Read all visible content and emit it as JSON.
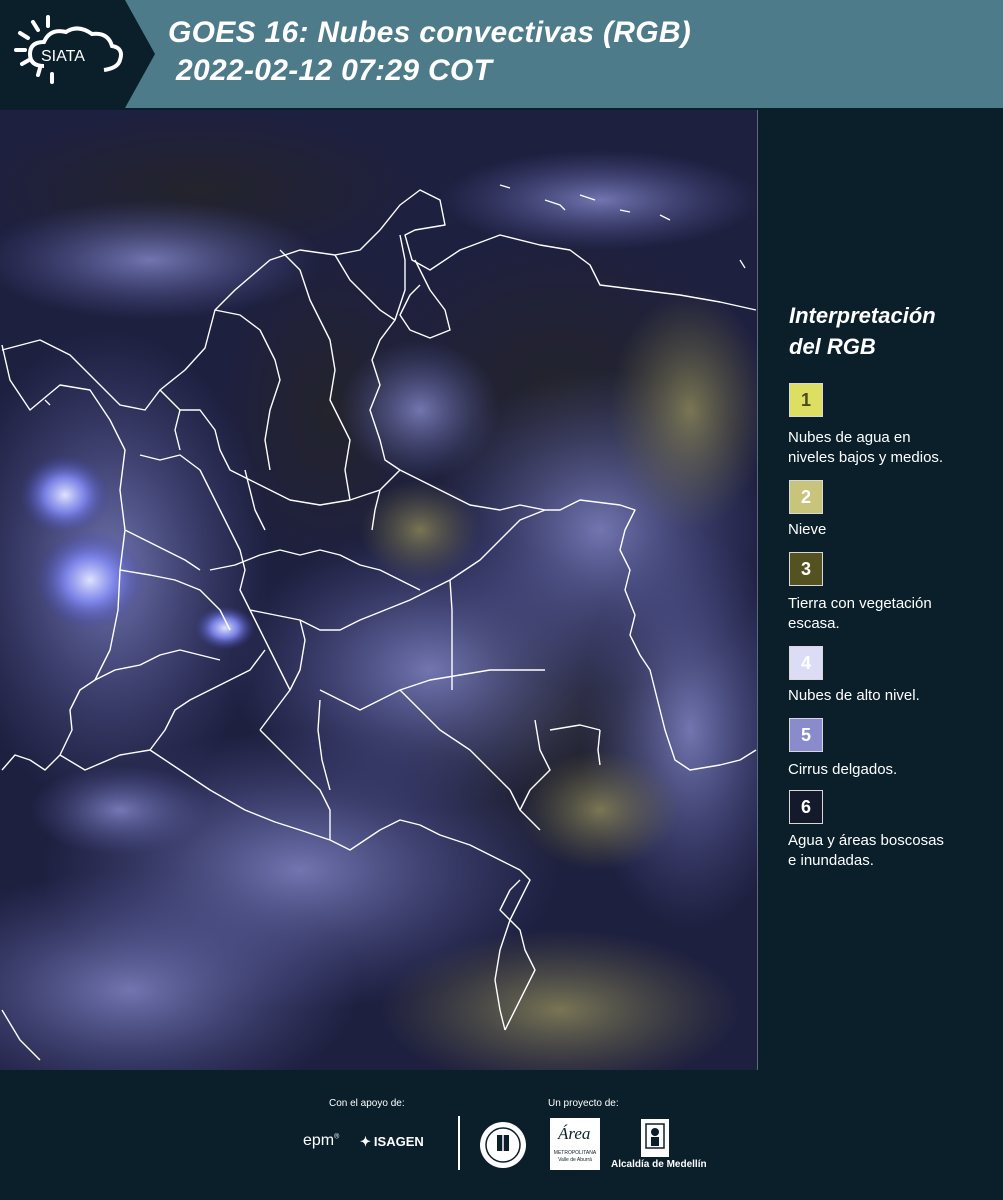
{
  "header": {
    "logo_text": "SIATA",
    "title_line1": "GOES 16: Nubes convectivas (RGB)",
    "title_line2": "2022-02-12 07:29 COT",
    "bg_color": "#4d7b89",
    "logo_bg_color": "#0b1f2b"
  },
  "map": {
    "description_icon": "satellite-rgb-image",
    "bg_color": "#1c1d3c"
  },
  "legend": {
    "title_line1": "Interpretación",
    "title_line2": "del RGB",
    "items": [
      {
        "number": "1",
        "label_line1": "Nubes de agua en",
        "label_line2": "niveles bajos y medios.",
        "color": "#dede63",
        "text_color": "#4a4a1a"
      },
      {
        "number": "2",
        "label_line1": "Nieve",
        "label_line2": "",
        "color": "#c8c47c",
        "text_color": "#ffffff"
      },
      {
        "number": "3",
        "label_line1": "Tierra con vegetación",
        "label_line2": "escasa.",
        "color": "#545221",
        "text_color": "#ffffff"
      },
      {
        "number": "4",
        "label_line1": "Nubes de alto nivel.",
        "label_line2": "",
        "color": "#dcdcf6",
        "text_color": "#ffffff"
      },
      {
        "number": "5",
        "label_line1": "Cirrus delgados.",
        "label_line2": "",
        "color": "#8a8bcd",
        "text_color": "#ffffff"
      },
      {
        "number": "6",
        "label_line1": "Agua y áreas boscosas",
        "label_line2": "e inundadas.",
        "color": "#141a2c",
        "text_color": "#ffffff"
      }
    ]
  },
  "footer": {
    "support_label": "Con el apoyo de:",
    "project_label": "Un proyecto de:",
    "epm_text": "epm",
    "isagen_text": "ISAGEN",
    "metropolitana_text1": "METROPOLITANA",
    "metropolitana_text2": "Valle de Aburrá",
    "area_text": "Área",
    "alcaldia_text": "Alcaldía de Medellín",
    "medellin_seal_text": "MEDELLÍN"
  }
}
